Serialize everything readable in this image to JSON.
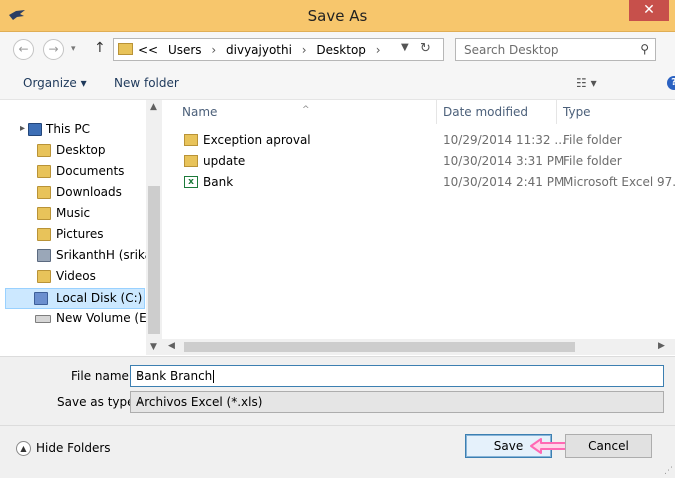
{
  "window": {
    "title": "Save As",
    "close_label": "✕"
  },
  "address_bar": {
    "overflow": "<<",
    "segments": [
      "Users",
      "divyajyothi",
      "Desktop"
    ],
    "separator": "›"
  },
  "search": {
    "placeholder": "Search Desktop"
  },
  "toolbar": {
    "organize_label": "Organize ▾",
    "new_folder_label": "New folder"
  },
  "nav_pane": {
    "items": [
      {
        "label": "This PC",
        "icon": "pc-icon"
      },
      {
        "label": "Desktop",
        "icon": "desktop-folder-icon"
      },
      {
        "label": "Documents",
        "icon": "documents-folder-icon"
      },
      {
        "label": "Downloads",
        "icon": "downloads-folder-icon"
      },
      {
        "label": "Music",
        "icon": "music-folder-icon"
      },
      {
        "label": "Pictures",
        "icon": "pictures-folder-icon"
      },
      {
        "label": "SrikanthH (srikan",
        "icon": "user-folder-icon"
      },
      {
        "label": "Videos",
        "icon": "videos-folder-icon"
      },
      {
        "label": "Local Disk (C:)",
        "icon": "drive-c-icon"
      },
      {
        "label": "New Volume (E:)",
        "icon": "drive-e-icon"
      }
    ],
    "selected": "Local Disk (C:)"
  },
  "file_list": {
    "columns": {
      "name": "Name",
      "date": "Date modified",
      "type": "Type"
    },
    "rows": [
      {
        "name": "Exception aproval",
        "date": "10/29/2014 11:32 ...",
        "type": "File folder",
        "icon": "folder-icon"
      },
      {
        "name": "update",
        "date": "10/30/2014 3:31 PM",
        "type": "File folder",
        "icon": "folder-icon"
      },
      {
        "name": "Bank",
        "date": "10/30/2014 2:41 PM",
        "type": "Microsoft Excel 97...",
        "icon": "excel-file-icon"
      }
    ]
  },
  "form": {
    "file_name_label": "File name:",
    "file_name_value": "Bank Branch",
    "save_type_label": "Save as type:",
    "save_type_value": "Archivos Excel (*.xls)"
  },
  "footer": {
    "hide_folders_label": "Hide Folders",
    "save_label": "Save",
    "cancel_label": "Cancel"
  },
  "colors": {
    "titlebar": "#f7c66c",
    "close": "#c7504b",
    "highlight_arrow": "#ff69b4"
  }
}
